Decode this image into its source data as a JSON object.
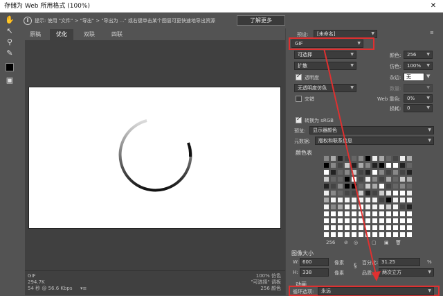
{
  "window": {
    "title": "存储为 Web 所用格式 (100%)",
    "close_label": "✕"
  },
  "infobar": {
    "hint": "提示: 使用 \"文件\" > \"导出\" > \"导出为 ...\" 或右键单击某个图层可更快速地导出资源",
    "learn_more": "了解更多"
  },
  "tabs": [
    {
      "label": "原稿",
      "active": false
    },
    {
      "label": "优化",
      "active": true
    },
    {
      "label": "双联",
      "active": false
    },
    {
      "label": "四联",
      "active": false
    }
  ],
  "status": {
    "left": [
      "GIF",
      "294.7K",
      "54 秒 @ 56.6 Kbps"
    ],
    "right": [
      "100% 仿色",
      "\"可选择\" 调板",
      "256 颜色"
    ]
  },
  "panel": {
    "preset_label": "预设:",
    "preset_value": "[未命名]",
    "format": "GIF",
    "reduction": "可选择",
    "colors_label": "颜色:",
    "colors_value": "256",
    "dither_algo": "扩散",
    "dither_label": "仿色:",
    "dither_value": "100%",
    "transparency_label": "透明度",
    "transparency_checked": true,
    "matte_label": "杂边:",
    "matte_value": "无",
    "transp_dither": "无透明度仿色",
    "amount_label": "数量:",
    "interlaced_label": "交错",
    "interlaced_checked": false,
    "websnap_label": "Web 靠色:",
    "websnap_value": "0%",
    "lossy_label": "损耗:",
    "lossy_value": "0",
    "srgb_label": "转换为 sRGB",
    "srgb_checked": true,
    "preview_label": "预览:",
    "preview_value": "显示器颜色",
    "metadata_label": "元数据:",
    "metadata_value": "版权和联系信息",
    "color_table_title": "颜色表",
    "color_count": "256",
    "image_size_title": "图像大小",
    "w_label": "W:",
    "w_value": "600",
    "w_unit": "像素",
    "h_label": "H:",
    "h_value": "338",
    "h_unit": "像素",
    "percent_label": "百分比:",
    "percent_value": "31.25",
    "percent_unit": "%",
    "quality_label": "品质:",
    "quality_value": "两次立方",
    "animation_title": "动画",
    "loop_label": "循环选项:",
    "loop_value": "永远"
  },
  "accent": {
    "highlight": "#e03030",
    "spinner": "#111111"
  }
}
